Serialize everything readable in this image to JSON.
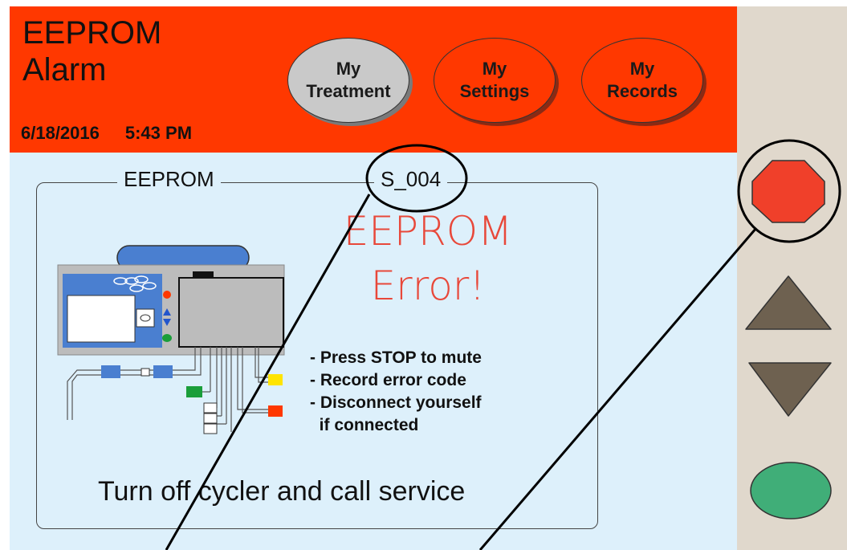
{
  "header": {
    "title_line1": "EEPROM",
    "title_line2": "Alarm",
    "date": "6/18/2016",
    "time": "5:43 PM"
  },
  "nav": [
    {
      "line1": "My",
      "line2": "Treatment",
      "active": true
    },
    {
      "line1": "My",
      "line2": "Settings",
      "active": false
    },
    {
      "line1": "My",
      "line2": "Records",
      "active": false
    }
  ],
  "panel": {
    "legend_name": "EEPROM",
    "error_code": "S_004",
    "error_line1": "EEPROM",
    "error_line2": "Error!",
    "instructions": [
      "- Press STOP to mute",
      "- Record error code",
      "- Disconnect yourself",
      "  if connected"
    ],
    "footer": "Turn off cycler and call service"
  },
  "side_buttons": {
    "stop": "stop-icon",
    "up": "arrow-up-icon",
    "down": "arrow-down-icon",
    "ok": "ok-icon"
  },
  "colors": {
    "header_bg": "#ff3800",
    "screen_bg": "#ddf0fb",
    "side_bg": "#e0d8cc",
    "error_text": "#e8483a",
    "stop_red": "#f0402a",
    "arrow_brown": "#6e6150",
    "ok_green": "#40ae78"
  }
}
